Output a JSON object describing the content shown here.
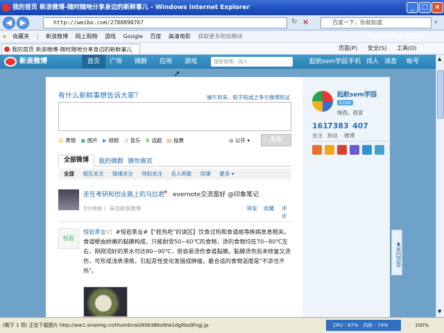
{
  "window": {
    "title": "我的首页  新浪微博-随时随地分享身边的新鲜事儿 - Windows Internet Explorer"
  },
  "address": {
    "url": "http://weibo.com/2788890767",
    "search_placeholder": "百度一下，你就知道"
  },
  "favorites": {
    "label": "收藏夹",
    "items": [
      "新浪微博",
      "网上购物",
      "游戏",
      "Google",
      "百度",
      "高清电影",
      "获取更多附加模块"
    ]
  },
  "tab": {
    "title": "我的首页  新浪微博-随时随地分享身边的新鲜事儿"
  },
  "commands": [
    "页面(P)",
    "安全(S)",
    "工具(O)"
  ],
  "watermark": "tv.sohu.com",
  "weibo_nav": {
    "logo": "新浪微博",
    "items": [
      "首页",
      "广场",
      "微群",
      "应用",
      "游戏"
    ],
    "search_placeholder": "搜索微博、找人",
    "right": [
      "起航sem学园",
      "手机",
      "找人",
      "消息",
      "帐号"
    ]
  },
  "composer": {
    "prompt": "有什么新鲜事想告诉大家？",
    "hot_topic": "端午到来，粽子陷成之争引微博热议",
    "tools": [
      "表情",
      "图片",
      "视频",
      "音乐",
      "话题",
      "投票"
    ],
    "visibility": "公开",
    "post_label": "发布"
  },
  "feed_tabs": [
    "全部微博",
    "我的微群",
    "猜你喜欢"
  ],
  "filters": [
    "全部",
    "相互关注",
    "情绪关注",
    "特别关注",
    "名人明星",
    "同事",
    "更多"
  ],
  "posts": [
    {
      "author": "走在考研和创业路上的马拉君",
      "text": "evernote交流蛮好  @印象笔记",
      "time": "5分钟前",
      "source": "来自新浪微博",
      "actions": [
        "转发",
        "收藏",
        "评论"
      ]
    },
    {
      "avatar_text": "恒岩",
      "author": "恒岩茶业",
      "text": "#恒岩茶业#【\"趁热吃\"的误区】饮食过热和食道癌等疾病息息相关。食道壁由娇嫩的黏膜构成，只能耐受50~60℃的食物，烫的食物均在70~80℃左右，刚刚沏好的茶水可达80~90℃，很容易烫伤食道黏膜。黏膜烫伤后未修复又烫伤，可形成浅表溃疡，引起恶性变化发展成肿瘤。最合适的食物温度是\"不凉也不热\"。"
    }
  ],
  "profile": {
    "name": "起航sem学园",
    "badge": "Ccxs",
    "location": "陕西，西安",
    "stats": [
      {
        "count": "161",
        "label": "关注"
      },
      {
        "count": "7383",
        "label": "粉丝"
      },
      {
        "count": "407",
        "label": "微博"
      }
    ]
  },
  "back_to_top": "返回顶部",
  "status": {
    "text": "(剩下 1 项) 正在下载图片 http://ww1.sinaimg.cn/thumbnail/80b386a9tw1dg8ba9fngj.jp",
    "cpu": "CPU : 67%",
    "memory": "内存 : 74%",
    "zoom": "100%"
  }
}
